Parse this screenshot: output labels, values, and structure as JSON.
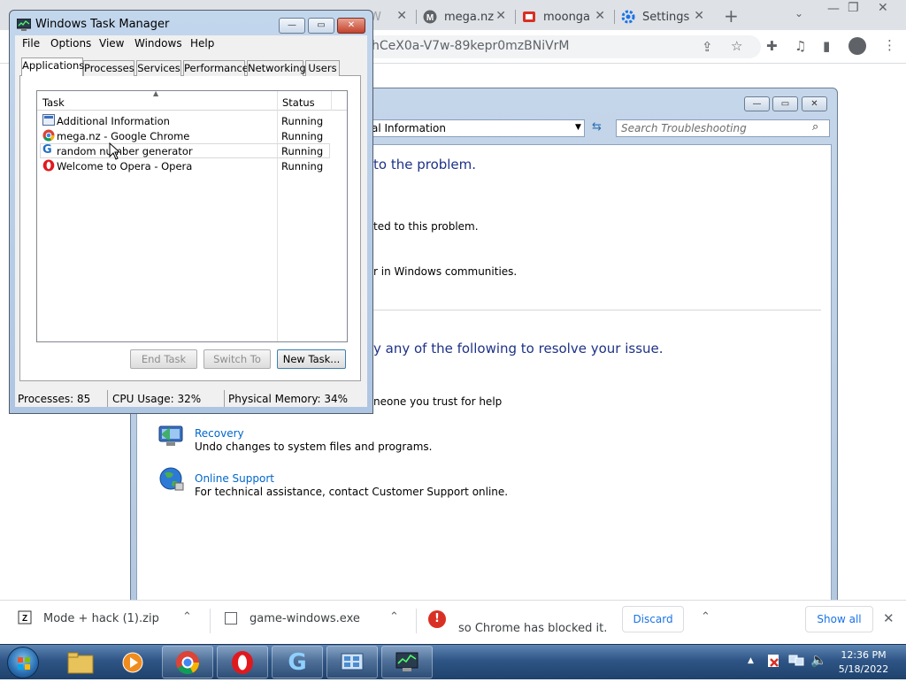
{
  "chrome": {
    "tabs": [
      {
        "label": "W"
      },
      {
        "label": "mega.nz"
      },
      {
        "label": "moonga"
      },
      {
        "label": "Settings"
      }
    ],
    "url": "hCeX0a-V7w-89kepr0mzBNiVrM"
  },
  "troubleshooting": {
    "address": "al Information",
    "search_placeholder": "Search Troubleshooting",
    "heading1": "to the problem.",
    "line1": "ted to this problem.",
    "line2": "r in Windows communities.",
    "heading2": "y any of the following to resolve your issue.",
    "line3": "neone you trust for help",
    "recovery": {
      "title": "Recovery",
      "desc": "Undo changes to system files and programs."
    },
    "online_support": {
      "title": "Online Support",
      "desc": "For technical assistance, contact Customer Support online."
    }
  },
  "task_manager": {
    "title": "Windows Task Manager",
    "menu": [
      "File",
      "Options",
      "View",
      "Windows",
      "Help"
    ],
    "tabs": [
      "Applications",
      "Processes",
      "Services",
      "Performance",
      "Networking",
      "Users"
    ],
    "columns": {
      "task": "Task",
      "status": "Status"
    },
    "rows": [
      {
        "task": "Additional Information",
        "status": "Running"
      },
      {
        "task": "mega.nz - Google Chrome",
        "status": "Running"
      },
      {
        "task": "random number generator",
        "status": "Running"
      },
      {
        "task": "Welcome to Opera - Opera",
        "status": "Running"
      }
    ],
    "buttons": {
      "end_task": "End Task",
      "switch_to": "Switch To",
      "new_task": "New Task..."
    },
    "status": {
      "processes": "Processes: 85",
      "cpu": "CPU Usage: 32%",
      "memory": "Physical Memory: 34%"
    }
  },
  "downloads": {
    "items": [
      {
        "name": "Mode + hack (1).zip"
      },
      {
        "name": "game-windows.exe"
      }
    ],
    "warning": "so Chrome has blocked it.",
    "discard_label": "Discard",
    "show_all_label": "Show all"
  },
  "taskbar": {
    "time": "12:36 PM",
    "date": "5/18/2022"
  },
  "icons": {
    "chrome_accent": "#1a73e8",
    "opera_red": "#e0191e",
    "heading_blue": "#1e3287"
  }
}
